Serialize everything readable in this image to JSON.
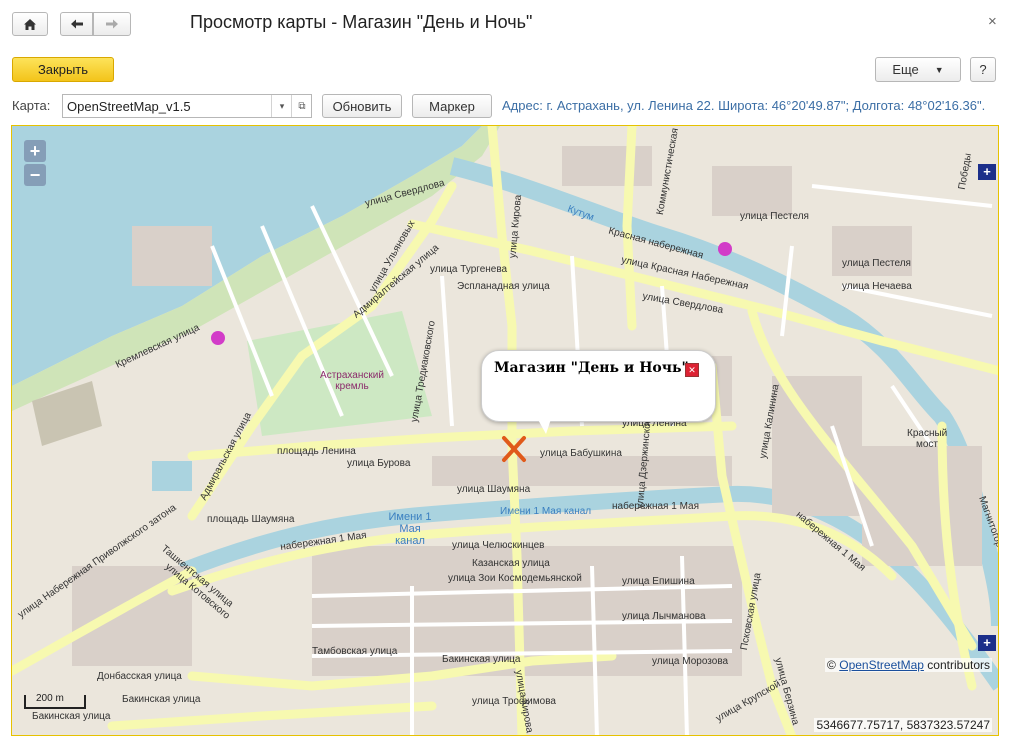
{
  "window": {
    "title": "Просмотр карты - Магазин \"День и Ночь\"",
    "close_glyph": "×"
  },
  "toolbar": {
    "close_label": "Закрыть",
    "more_label": "Еще",
    "help_label": "?"
  },
  "map_controls": {
    "map_label": "Карта:",
    "map_value": "OpenStreetMap_v1.5",
    "refresh_label": "Обновить",
    "marker_label": "Маркер",
    "address": "Адрес: г. Астрахань, ул. Ленина 22. Широта: 46°20'49.87\"; Долгота: 48°02'16.36\"."
  },
  "map": {
    "zoom_in": "+",
    "zoom_out": "−",
    "popup_title": "Магазин \"День и Ночь\"",
    "attribution_prefix": "©",
    "attribution_link": "OpenStreetMap",
    "attribution_suffix": "contributors",
    "scale": "200 m",
    "coordinates": "5346677.75717, 5837323.57247",
    "colors": {
      "water": "#aad3df",
      "major_road": "#f7f9b0",
      "block": "#d9d0c9",
      "park": "#cde8c3",
      "marker": "#e05a1a"
    },
    "labels": {
      "sverdlova_1": "улица Свердлова",
      "sverdlova_2": "улица Свердлова",
      "admiralteyskaya": "Адмиралтейская улица",
      "admiralskaya": "Адмиральская улица",
      "kremlin": "Астраханский кремль",
      "tredyakovskogo": "улица Тредиаковского",
      "kirova": "улица Кирова",
      "kirova_2": "улица Кирова",
      "lenina_sq": "площадь Ленина",
      "lenina": "улица Ленина",
      "burova": "улица Бурова",
      "shaumyana": "улица Шаумяна",
      "shaumyana_sq": "площадь Шаумяна",
      "babushkina": "улица Бабушкина",
      "nab1maya_1": "набережная 1 Мая",
      "nab1maya_2": "набережная 1 Мая",
      "nab1maya_3": "набережная 1 Мая",
      "kanal": "Имени 1 Мая канал",
      "kanal_2": "Имени 1 Мая канал",
      "kutum": "Кутум",
      "krasnaya_nab": "Красная набережная",
      "krasnaya_nab_2": "улица Красная Набережная",
      "kommunisticheskaya": "Коммунистическая",
      "pestelya": "улица Пестеля",
      "nechaeva": "улица Нечаева",
      "bakinskaya_1": "Бакинская улица",
      "bakinskaya_2": "Бакинская улица",
      "bakinskaya_3": "Бакинская улица",
      "privolzhskogo": "улица Набережная Приволжского затона",
      "kosmonavtov": "улица Котовского",
      "chelyuskintsev": "улица Челюскинцев",
      "kazanskaya": "Казанская улица",
      "epishina": "улица Епишина",
      "lychmanova": "улица Лычманова",
      "morozova": "улица Морозова",
      "trofimova": "улица Трофимова",
      "pskovskaya": "Псковская улица",
      "krasny_most": "Красный мост",
      "tashkentskaya": "Ташкентская улица",
      "kremlevskaya": "Кремлевская улица",
      "turgeneva": "улица Тургенева",
      "esplanadnaya": "Эспланадная улица",
      "tambovskaya": "Тамбовская улица",
      "dontsovskaya": "Донбасская улица",
      "ulyanovykh": "улица Ульяновых",
      "pobedy": "Победы",
      "magnitogorskaya": "Магнитогорская",
      "krupskoy": "улица Крупской",
      "berzina": "улица Берзина",
      "dzerzhinskogo": "улица Дзержинского",
      "zoi": "улица Зои Космодемьянской",
      "kalinina": "улица Калинина"
    }
  }
}
